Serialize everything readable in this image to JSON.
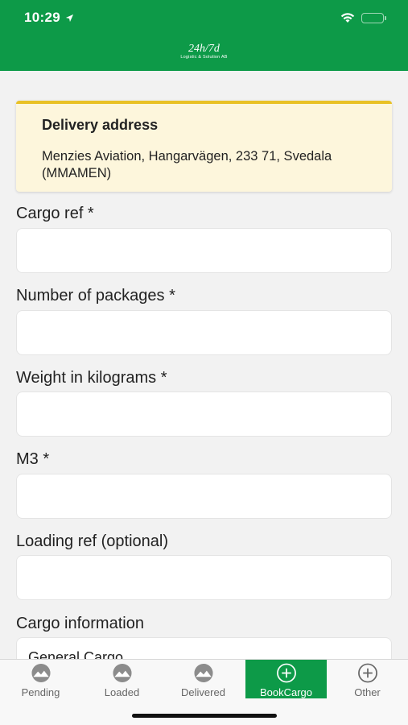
{
  "status_bar": {
    "time": "10:29"
  },
  "header": {
    "logo_main": "24h/7d",
    "logo_sub": "Logistic & Solution AB"
  },
  "delivery": {
    "title": "Delivery address",
    "address": "Menzies Aviation, Hangarvägen, 233 71, Svedala (MMAMEN)"
  },
  "form": {
    "cargo_ref_label": "Cargo ref *",
    "packages_label": "Number of packages *",
    "weight_label": "Weight in kilograms *",
    "m3_label": "M3 *",
    "loading_ref_label": "Loading ref (optional)",
    "cargo_info_label": "Cargo information",
    "cargo_info_value": "General Cargo"
  },
  "tabs": [
    {
      "label": "Pending",
      "icon": "mountain-circle-icon"
    },
    {
      "label": "Loaded",
      "icon": "mountain-circle-icon"
    },
    {
      "label": "Delivered",
      "icon": "mountain-circle-icon"
    },
    {
      "label": "BookCargo",
      "icon": "plus-circle-icon"
    },
    {
      "label": "Other",
      "icon": "plus-circle-icon"
    }
  ],
  "colors": {
    "brand_green": "#0d9a48",
    "card_accent": "#e9c125",
    "card_bg": "#fdf6dc"
  }
}
